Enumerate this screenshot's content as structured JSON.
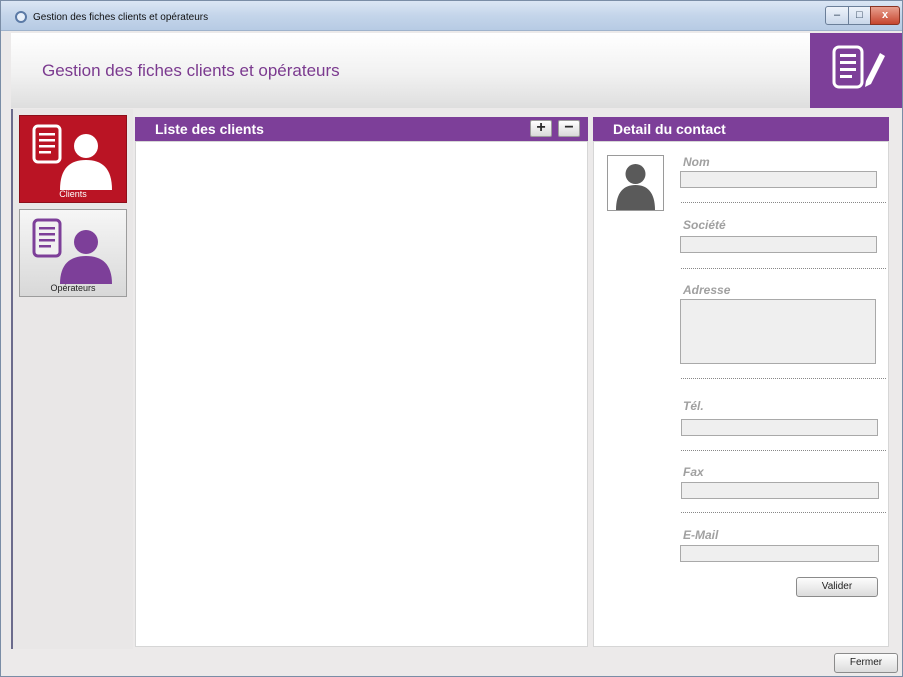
{
  "window": {
    "title": "Gestion des fiches clients et opérateurs",
    "controls": {
      "minimize": "–",
      "maximize": "□",
      "close": "x"
    }
  },
  "header": {
    "title": "Gestion des fiches clients et opérateurs",
    "logo_icon": "document-edit-icon",
    "accent_color": "#7d3f99"
  },
  "nav": {
    "items": [
      {
        "label": "Clients",
        "icon": "client-contact-icon",
        "active": true,
        "color": "#ba1424"
      },
      {
        "label": "Opérateurs",
        "icon": "operator-contact-icon",
        "active": false
      }
    ]
  },
  "list_panel": {
    "title": "Liste des clients",
    "add_label": "+",
    "remove_label": "−",
    "items": []
  },
  "detail_panel": {
    "title": "Detail du contact",
    "avatar_icon": "person-silhouette-icon",
    "fields": {
      "nom": {
        "label": "Nom",
        "value": ""
      },
      "societe": {
        "label": "Société",
        "value": ""
      },
      "adresse": {
        "label": "Adresse",
        "value": ""
      },
      "tel": {
        "label": "Tél.",
        "value": ""
      },
      "fax": {
        "label": "Fax",
        "value": ""
      },
      "email": {
        "label": "E-Mail",
        "value": ""
      }
    },
    "submit_label": "Valider"
  },
  "footer": {
    "close_label": "Fermer"
  }
}
